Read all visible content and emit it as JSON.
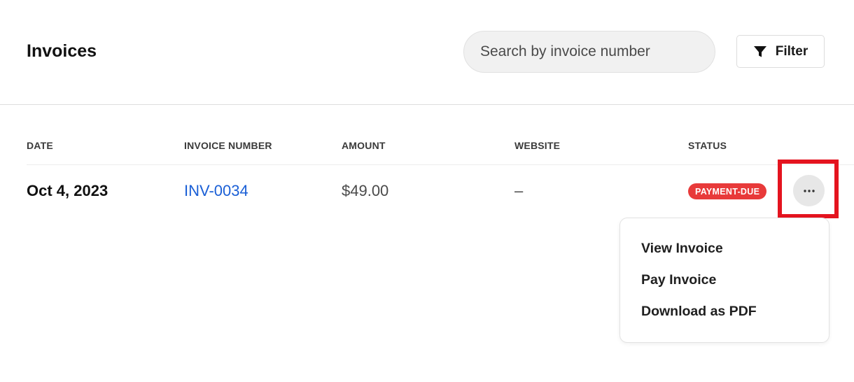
{
  "header": {
    "title": "Invoices",
    "search_placeholder": "Search by invoice number",
    "filter_label": "Filter"
  },
  "table": {
    "columns": [
      "DATE",
      "INVOICE NUMBER",
      "AMOUNT",
      "WEBSITE",
      "STATUS"
    ],
    "rows": [
      {
        "date": "Oct 4, 2023",
        "invoice_number": "INV-0034",
        "amount": "$49.00",
        "website": "–",
        "status": "PAYMENT-DUE"
      }
    ]
  },
  "row_menu": {
    "items": [
      "View Invoice",
      "Pay Invoice",
      "Download as PDF"
    ]
  },
  "icons": {
    "filter": "filter-icon",
    "more": "more-horizontal-icon"
  },
  "colors": {
    "link": "#1a5fd6",
    "status_due": "#e83a3a",
    "highlight": "#e4141f",
    "search_bg": "#f1f1f1"
  }
}
